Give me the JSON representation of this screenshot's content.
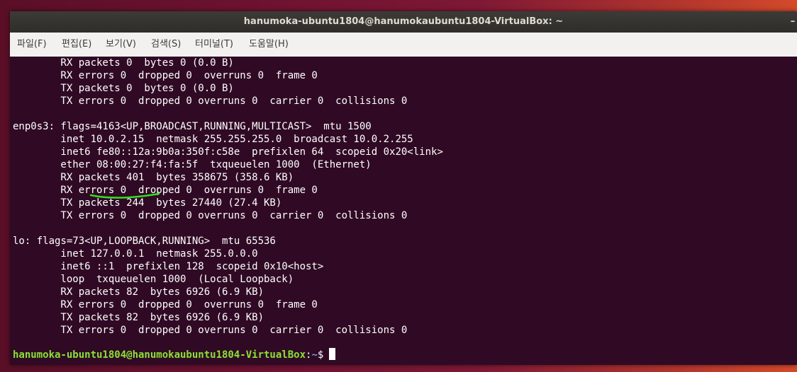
{
  "window": {
    "title": "hanumoka-ubuntu1804@hanumokaubuntu1804-VirtualBox: ~"
  },
  "menubar": {
    "items": [
      "파일(F)",
      "편집(E)",
      "보기(V)",
      "검색(S)",
      "터미널(T)",
      "도움말(H)"
    ]
  },
  "terminal": {
    "lines": [
      "        RX packets 0  bytes 0 (0.0 B)",
      "        RX errors 0  dropped 0  overruns 0  frame 0",
      "        TX packets 0  bytes 0 (0.0 B)",
      "        TX errors 0  dropped 0 overruns 0  carrier 0  collisions 0",
      "",
      "enp0s3: flags=4163<UP,BROADCAST,RUNNING,MULTICAST>  mtu 1500",
      "        inet 10.0.2.15  netmask 255.255.255.0  broadcast 10.0.2.255",
      "        inet6 fe80::12a:9b0a:350f:c58e  prefixlen 64  scopeid 0x20<link>",
      "        ether 08:00:27:f4:fa:5f  txqueuelen 1000  (Ethernet)",
      "        RX packets 401  bytes 358675 (358.6 KB)",
      "        RX errors 0  dropped 0  overruns 0  frame 0",
      "        TX packets 244  bytes 27440 (27.4 KB)",
      "        TX errors 0  dropped 0 overruns 0  carrier 0  collisions 0",
      "",
      "lo: flags=73<UP,LOOPBACK,RUNNING>  mtu 65536",
      "        inet 127.0.0.1  netmask 255.0.0.0",
      "        inet6 ::1  prefixlen 128  scopeid 0x10<host>",
      "        loop  txqueuelen 1000  (Local Loopback)",
      "        RX packets 82  bytes 6926 (6.9 KB)",
      "        RX errors 0  dropped 0  overruns 0  frame 0",
      "        TX packets 82  bytes 6926 (6.9 KB)",
      "        TX errors 0  dropped 0 overruns 0  carrier 0  collisions 0"
    ],
    "prompt": {
      "user_host": "hanumoka-ubuntu1804@hanumokaubuntu1804-VirtualBox",
      "separator": ":",
      "path": "~",
      "symbol": "$"
    }
  },
  "colors": {
    "terminal_bg": "#300a24",
    "prompt_user": "#8ae234",
    "prompt_path": "#729fcf",
    "annotation": "#33dd22"
  },
  "icons": {
    "title_menu": "hamburger-menu-icon"
  }
}
